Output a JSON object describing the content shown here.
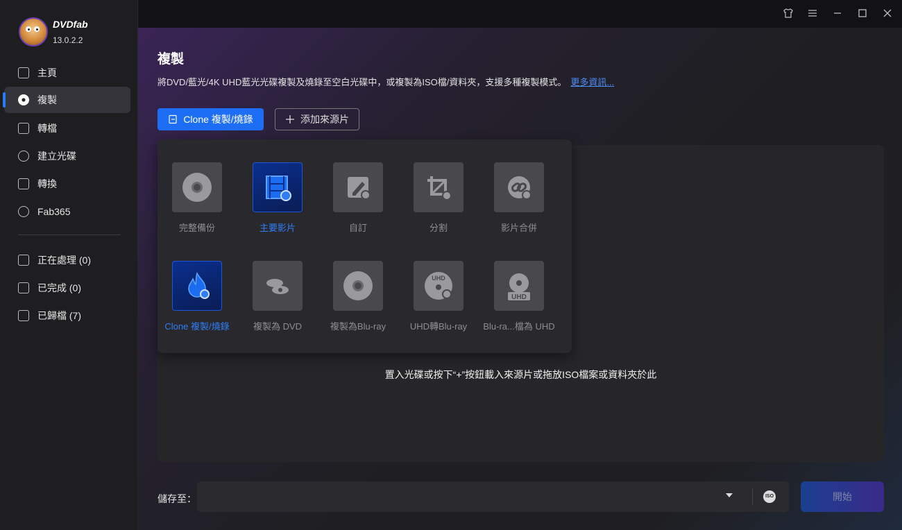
{
  "app": {
    "brand": "DVDfab",
    "version": "13.0.2.2"
  },
  "window_controls": [
    "shirt-icon",
    "menu-icon",
    "minimize-icon",
    "maximize-icon",
    "close-icon"
  ],
  "sidebar": {
    "items": [
      {
        "label": "主頁",
        "icon": "home-icon"
      },
      {
        "label": "複製",
        "icon": "disc-copy-icon",
        "active": true
      },
      {
        "label": "轉檔",
        "icon": "convert-icon"
      },
      {
        "label": "建立光碟",
        "icon": "create-disc-icon"
      },
      {
        "label": "轉換",
        "icon": "film-icon"
      },
      {
        "label": "Fab365",
        "icon": "fab365-icon"
      }
    ],
    "queue": [
      {
        "label": "正在處理 (0)",
        "icon": "processing-icon"
      },
      {
        "label": "已完成 (0)",
        "icon": "completed-icon"
      },
      {
        "label": "已歸檔 (7)",
        "icon": "archive-icon"
      }
    ]
  },
  "main": {
    "title": "複製",
    "description": "將DVD/藍光/4K UHD藍光光碟複製及燒錄至空白光碟中，或複製為ISO檔/資料夾，支援多種複製模式。",
    "more_link": "更多資訊...",
    "clone_button": "Clone 複製/燒錄",
    "add_source_button": "添加來源片",
    "drop_hint": "置入光碟或按下“+”按鈕載入來源片或拖放ISO檔案或資料夾於此",
    "modes_row1": [
      {
        "label": "完整備份",
        "icon": "full-disc-icon"
      },
      {
        "label": "主要影片",
        "icon": "main-movie-icon",
        "selected": true
      },
      {
        "label": "自訂",
        "icon": "customize-icon"
      },
      {
        "label": "分割",
        "icon": "split-icon"
      },
      {
        "label": "影片合併",
        "icon": "merge-icon"
      }
    ],
    "modes_row2": [
      {
        "label": "Clone 複製/燒錄",
        "icon": "clone-flame-icon",
        "selected": true
      },
      {
        "label": "複製為 DVD",
        "icon": "bluray-to-dvd-icon"
      },
      {
        "label": "複製為Blu-ray",
        "icon": "bluray-disc-icon"
      },
      {
        "label": "UHD轉Blu-ray",
        "icon": "uhd-bluray-icon"
      },
      {
        "label": "Blu-ra...檔為 UHD",
        "icon": "uhd-disc-icon"
      }
    ],
    "save_label": "儲存至：",
    "path_value": "",
    "start_button": "開始",
    "iso_text": "ISO"
  },
  "colors": {
    "accent": "#1e6ef5",
    "link": "#4f8ef7",
    "sidebar_bg": "#1e1e21"
  }
}
